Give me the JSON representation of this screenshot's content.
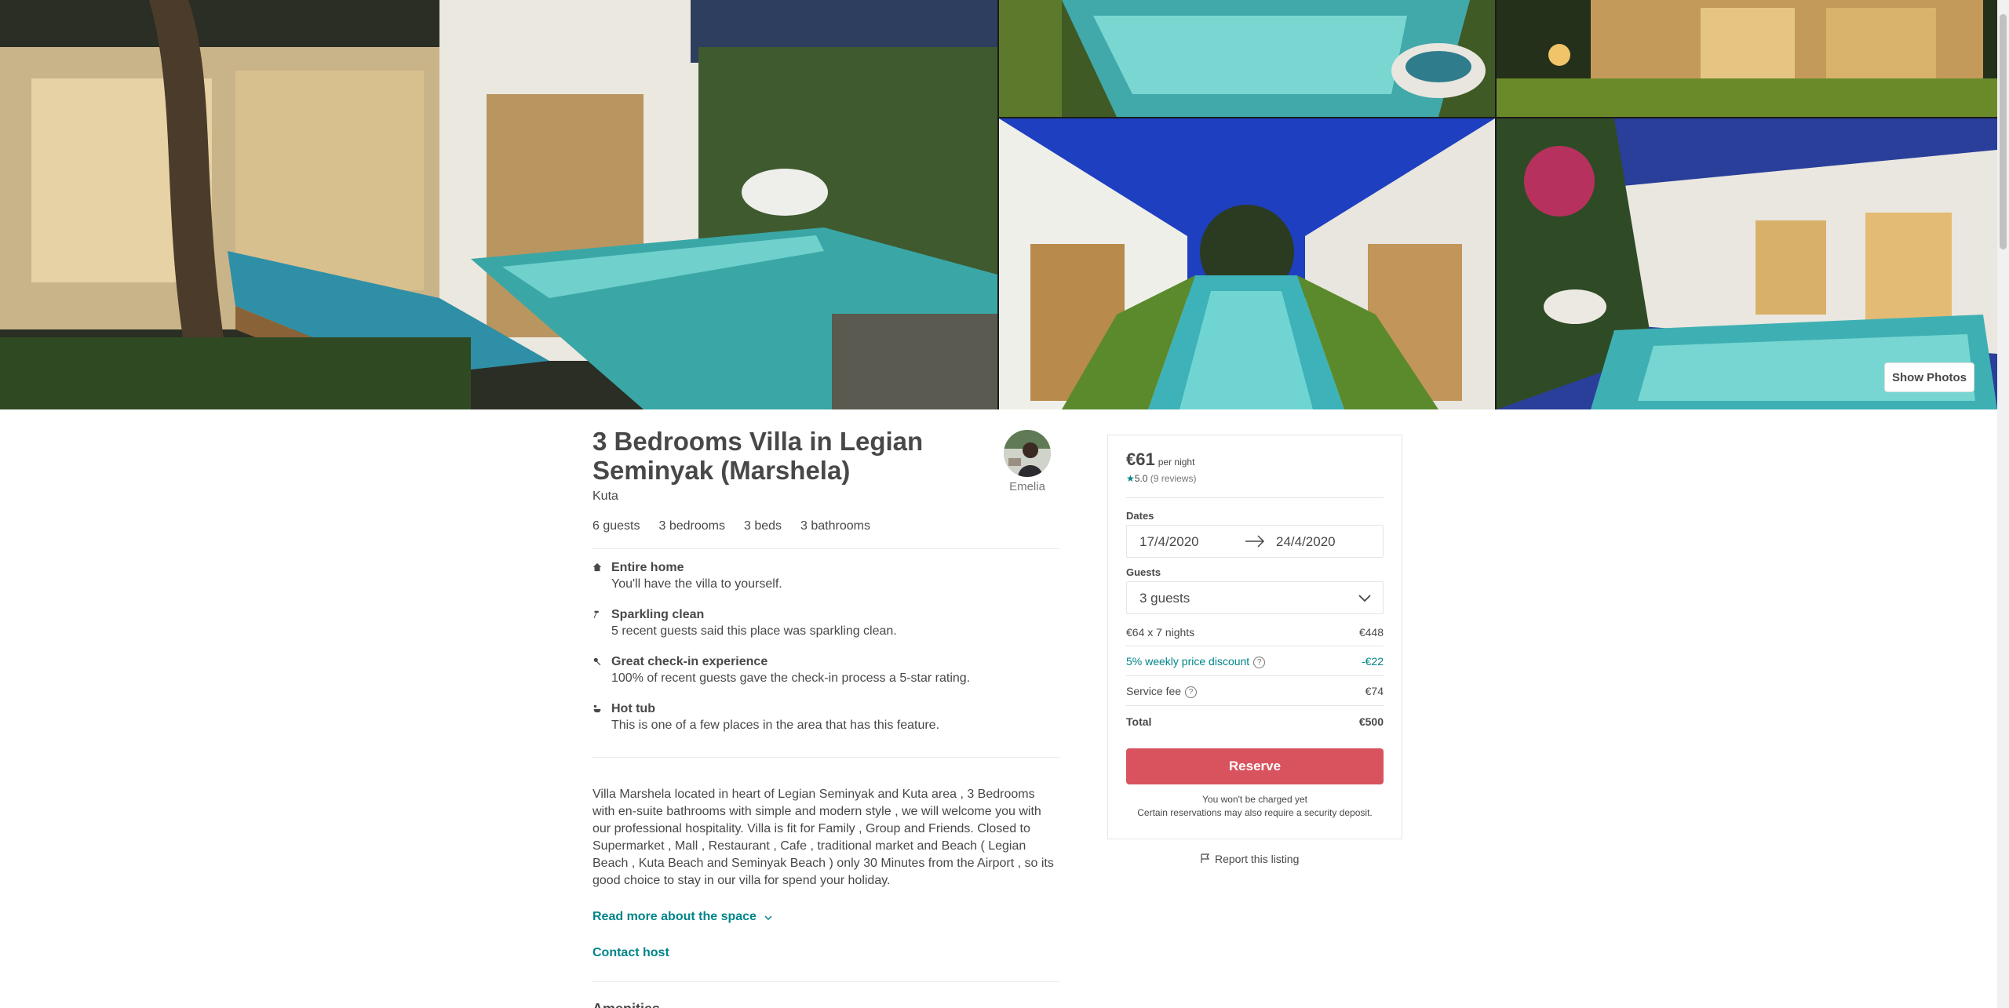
{
  "gallery": {
    "show_photos_label": "Show Photos"
  },
  "listing": {
    "title": "3 Bedrooms Villa in Legian Seminyak (Marshela)",
    "location": "Kuta",
    "host_name": "Emelia",
    "facts": [
      "6 guests",
      "3 bedrooms",
      "3 beds",
      "3 bathrooms"
    ],
    "highlights": [
      {
        "icon": "home-icon",
        "title": "Entire home",
        "desc": "You'll have the villa to yourself."
      },
      {
        "icon": "sparkle-icon",
        "title": "Sparkling clean",
        "desc": "5 recent guests said this place was sparkling clean."
      },
      {
        "icon": "key-icon",
        "title": "Great check-in experience",
        "desc": "100% of recent guests gave the check-in process a 5-star rating."
      },
      {
        "icon": "hot-tub-icon",
        "title": "Hot tub",
        "desc": "This is one of a few places in the area that has this feature."
      }
    ],
    "description": "Villa Marshela located in heart of Legian Seminyak and Kuta area , 3 Bedrooms with en-suite bathrooms with simple and modern style , we will welcome you with our professional hospitality. Villa is fit for Family , Group and Friends. Closed to Supermarket , Mall , Restaurant , Cafe , traditional market and Beach ( Legian Beach , Kuta Beach and Seminyak Beach ) only 30 Minutes from the Airport , so its good choice to stay in our villa for spend your holiday.",
    "read_more_label": "Read more about the space",
    "contact_host_label": "Contact host",
    "amenities_heading": "Amenities"
  },
  "booking": {
    "price": "€61",
    "per_night": "per night",
    "rating": "5.0",
    "reviews": "(9 reviews)",
    "dates_label": "Dates",
    "check_in": "17/4/2020",
    "check_out": "24/4/2020",
    "guests_label": "Guests",
    "guests_value": "3 guests",
    "nightly_label": "€64 x 7 nights",
    "nightly_amount": "€448",
    "discount_label": "5% weekly price discount",
    "discount_amount": "-€22",
    "service_label": "Service fee",
    "service_amount": "€74",
    "total_label": "Total",
    "total_amount": "€500",
    "reserve_label": "Reserve",
    "note_charge": "You won't be charged yet",
    "note_deposit": "Certain reservations may also require a security deposit."
  },
  "report_label": "Report this listing",
  "colors": {
    "accent_teal": "#008489",
    "reserve_red": "#d9535e",
    "text": "#484848"
  }
}
